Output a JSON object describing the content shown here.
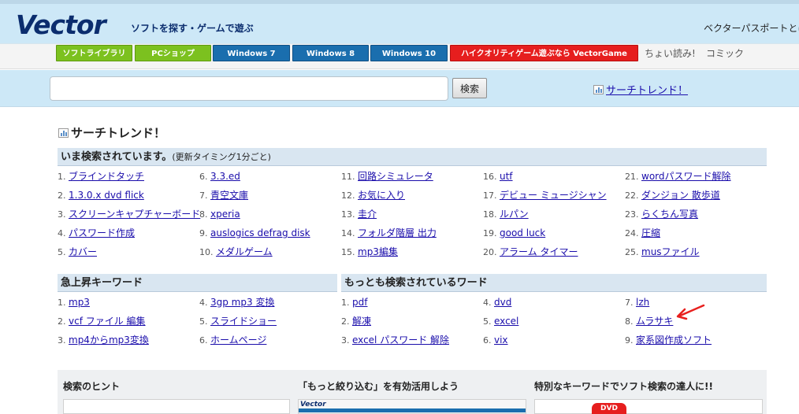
{
  "header": {
    "logo": "Vector",
    "tagline": "ソフトを探す・ゲームで遊ぶ",
    "passport": "ベクターパスポートとは"
  },
  "nav": {
    "buttons": [
      {
        "label": "ソフトライブラリ",
        "color": "green"
      },
      {
        "label": "PCショップ",
        "color": "green"
      },
      {
        "label": "Windows 7",
        "color": "blue"
      },
      {
        "label": "Windows 8",
        "color": "blue"
      },
      {
        "label": "Windows 10",
        "color": "blue"
      },
      {
        "label": "ハイクオリティゲーム遊ぶなら VectorGame",
        "color": "red"
      }
    ],
    "links": [
      "ちょい読み!",
      "コミック"
    ]
  },
  "search": {
    "input_value": "",
    "button_label": "検索",
    "trend_link": "サーチトレンド！"
  },
  "main": {
    "title": "サーチトレンド！",
    "now": {
      "heading": "いま検索されています。",
      "subheading": "(更新タイミング1分ごと)",
      "items": [
        "ブラインドタッチ",
        "1.3.0.x dvd flick",
        "スクリーンキャプチャーボード",
        "パスワード作成",
        "カバー",
        "3.3.ed",
        "青空文庫",
        "xperia",
        "auslogics defrag disk",
        "メダルゲーム",
        "回路シミュレータ",
        "お気に入り",
        "圭介",
        "フォルダ階層 出力",
        "mp3編集",
        "utf",
        "デビュー ミュージシャン",
        "ルパン",
        "good luck",
        "アラーム タイマー",
        "wordパスワード解除",
        "ダンジョン 散歩道",
        "らくちん写真",
        "圧縮",
        "musファイル"
      ]
    },
    "rising": {
      "heading": "急上昇キーワード",
      "items": [
        "mp3",
        "vcf ファイル 編集",
        "mp4からmp3変換",
        "3gp mp3 変換",
        "スライドショー",
        "ホームページ"
      ]
    },
    "popular": {
      "heading": "もっとも検索されているワード",
      "items": [
        "pdf",
        "解凍",
        "excel パスワード 解除",
        "dvd",
        "excel",
        "vix",
        "lzh",
        "ムラサキ",
        "家系図作成ソフト"
      ]
    }
  },
  "bottom": {
    "cards": [
      "検索のヒント",
      "「もっと絞り込む」を有効活用しよう",
      "特別なキーワードでソフト検索の達人に!!"
    ]
  },
  "colors": {
    "header_bg": "#cde8f7",
    "nav_green": "#7cc11f",
    "nav_blue": "#1a6eae",
    "nav_red": "#e61e1e",
    "link": "#1a0dab",
    "bar_bg": "#d9e6f1",
    "annotation_arrow": "#e8201e"
  }
}
